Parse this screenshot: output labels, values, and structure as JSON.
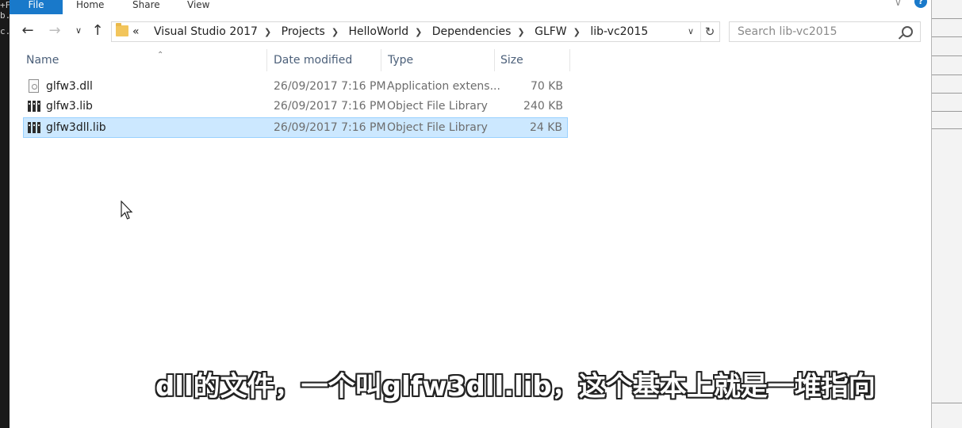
{
  "background": {
    "terminal_lines": [
      "+F",
      "b.c",
      "c.c"
    ]
  },
  "ribbon": {
    "tabs": [
      "File",
      "Home",
      "Share",
      "View"
    ],
    "expand_icon": "chevron-down-icon",
    "help_icon": "help-icon"
  },
  "navigation": {
    "back_icon": "arrow-left-icon",
    "forward_icon": "arrow-right-icon",
    "recent_icon": "chevron-down-icon",
    "up_icon": "arrow-up-icon"
  },
  "address_bar": {
    "overflow": "«",
    "crumbs": [
      "Visual Studio 2017",
      "Projects",
      "HelloWorld",
      "Dependencies",
      "GLFW",
      "lib-vc2015"
    ]
  },
  "search": {
    "placeholder": "Search lib-vc2015"
  },
  "columns": [
    "Name",
    "Date modified",
    "Type",
    "Size"
  ],
  "files": [
    {
      "name": "glfw3.dll",
      "date": "26/09/2017 7:16 PM",
      "type": "Application extens...",
      "size": "70 KB",
      "icon": "dll-file-icon",
      "selected": false
    },
    {
      "name": "glfw3.lib",
      "date": "26/09/2017 7:16 PM",
      "type": "Object File Library",
      "size": "240 KB",
      "icon": "lib-file-icon",
      "selected": false
    },
    {
      "name": "glfw3dll.lib",
      "date": "26/09/2017 7:16 PM",
      "type": "Object File Library",
      "size": "24 KB",
      "icon": "lib-file-icon",
      "selected": true
    }
  ],
  "subtitle": "dll的文件，一个叫glfw3dll.lib，这个基本上就是一堆指向",
  "colors": {
    "accent": "#1979ca",
    "selection": "#cce8ff",
    "selection_border": "#99d1ff"
  }
}
